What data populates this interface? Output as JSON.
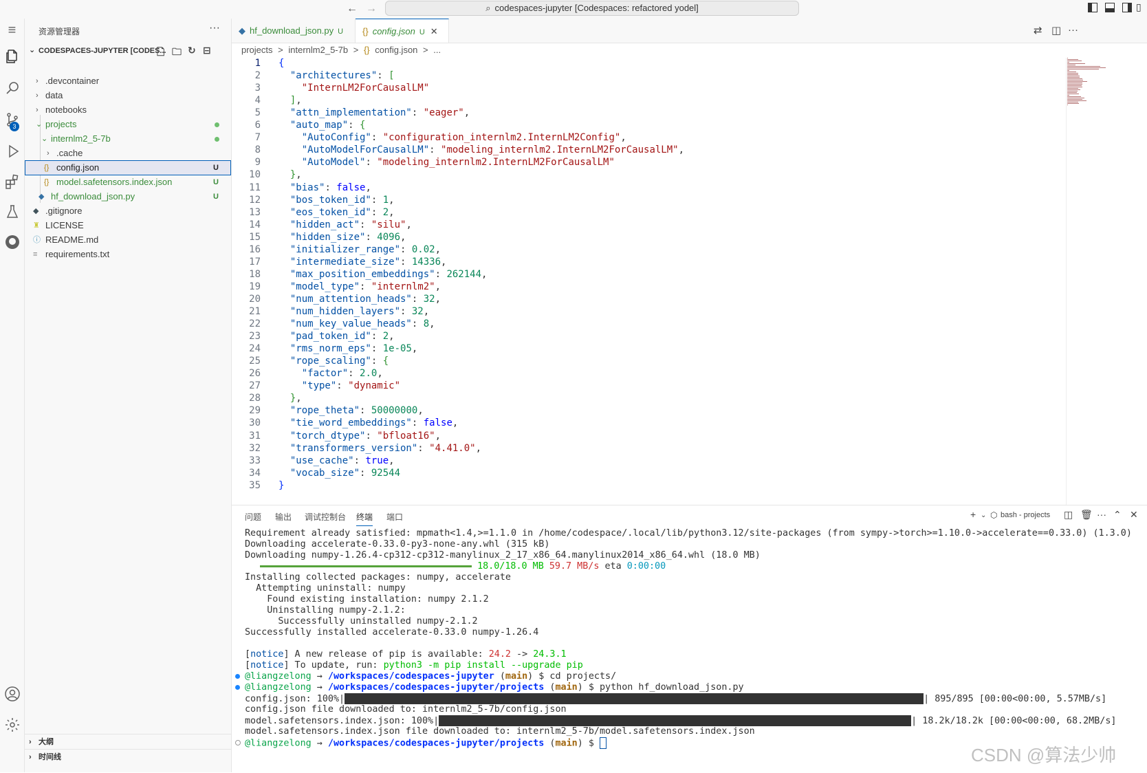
{
  "titlebar": {
    "command_center": "codespaces-jupyter [Codespaces: refactored yodel]",
    "back": "←",
    "forward": "→"
  },
  "activity": {
    "scm_badge": "3"
  },
  "sidebar": {
    "title": "资源管理器",
    "more": "···",
    "section": "CODESPACES-JUPYTER [CODES...",
    "tree": [
      {
        "label": ".devcontainer"
      },
      {
        "label": "data"
      },
      {
        "label": "notebooks"
      },
      {
        "label": "projects"
      },
      {
        "label": "internlm2_5-7b"
      },
      {
        "label": ".cache"
      },
      {
        "label": "config.json",
        "badge": "U",
        "icon": "{}"
      },
      {
        "label": "model.safetensors.index.json",
        "badge": "U",
        "icon": "{}"
      },
      {
        "label": "hf_download_json.py",
        "badge": "U"
      },
      {
        "label": ".gitignore"
      },
      {
        "label": "LICENSE"
      },
      {
        "label": "README.md"
      },
      {
        "label": "requirements.txt"
      }
    ],
    "outline": "大纲",
    "timeline": "时间线"
  },
  "tabs": [
    {
      "label": "hf_download_json.py",
      "mod": "U"
    },
    {
      "label": "config.json",
      "mod": "U",
      "icon": "{}",
      "close": "✕"
    }
  ],
  "breadcrumb": {
    "b1": "projects",
    "b2": "internlm2_5-7b",
    "icon": "{}",
    "b3": "config.json",
    "sep": ">",
    "b4": "..."
  },
  "editor": {
    "line_numbers": [
      "1",
      "2",
      "3",
      "4",
      "5",
      "6",
      "7",
      "8",
      "9",
      "10",
      "11",
      "12",
      "13",
      "14",
      "15",
      "16",
      "17",
      "18",
      "19",
      "20",
      "21",
      "22",
      "23",
      "24",
      "25",
      "26",
      "27",
      "28",
      "29",
      "30",
      "31",
      "32",
      "33",
      "34",
      "35"
    ],
    "lines": [
      [
        [
          "br1",
          "{"
        ]
      ],
      [
        [
          "p",
          "  "
        ],
        [
          "k",
          "\"architectures\""
        ],
        [
          "p",
          ": "
        ],
        [
          "br2",
          "["
        ]
      ],
      [
        [
          "p",
          "    "
        ],
        [
          "s",
          "\"InternLM2ForCausalLM\""
        ]
      ],
      [
        [
          "p",
          "  "
        ],
        [
          "br2",
          "]"
        ],
        [
          "p",
          ","
        ]
      ],
      [
        [
          "p",
          "  "
        ],
        [
          "k",
          "\"attn_implementation\""
        ],
        [
          "p",
          ": "
        ],
        [
          "s",
          "\"eager\""
        ],
        [
          "p",
          ","
        ]
      ],
      [
        [
          "p",
          "  "
        ],
        [
          "k",
          "\"auto_map\""
        ],
        [
          "p",
          ": "
        ],
        [
          "br2",
          "{"
        ]
      ],
      [
        [
          "p",
          "    "
        ],
        [
          "k",
          "\"AutoConfig\""
        ],
        [
          "p",
          ": "
        ],
        [
          "s",
          "\"configuration_internlm2.InternLM2Config\""
        ],
        [
          "p",
          ","
        ]
      ],
      [
        [
          "p",
          "    "
        ],
        [
          "k",
          "\"AutoModelForCausalLM\""
        ],
        [
          "p",
          ": "
        ],
        [
          "s",
          "\"modeling_internlm2.InternLM2ForCausalLM\""
        ],
        [
          "p",
          ","
        ]
      ],
      [
        [
          "p",
          "    "
        ],
        [
          "k",
          "\"AutoModel\""
        ],
        [
          "p",
          ": "
        ],
        [
          "s",
          "\"modeling_internlm2.InternLM2ForCausalLM\""
        ]
      ],
      [
        [
          "p",
          "  "
        ],
        [
          "br2",
          "}"
        ],
        [
          "p",
          ","
        ]
      ],
      [
        [
          "p",
          "  "
        ],
        [
          "k",
          "\"bias\""
        ],
        [
          "p",
          ": "
        ],
        [
          "b",
          "false"
        ],
        [
          "p",
          ","
        ]
      ],
      [
        [
          "p",
          "  "
        ],
        [
          "k",
          "\"bos_token_id\""
        ],
        [
          "p",
          ": "
        ],
        [
          "n",
          "1"
        ],
        [
          "p",
          ","
        ]
      ],
      [
        [
          "p",
          "  "
        ],
        [
          "k",
          "\"eos_token_id\""
        ],
        [
          "p",
          ": "
        ],
        [
          "n",
          "2"
        ],
        [
          "p",
          ","
        ]
      ],
      [
        [
          "p",
          "  "
        ],
        [
          "k",
          "\"hidden_act\""
        ],
        [
          "p",
          ": "
        ],
        [
          "s",
          "\"silu\""
        ],
        [
          "p",
          ","
        ]
      ],
      [
        [
          "p",
          "  "
        ],
        [
          "k",
          "\"hidden_size\""
        ],
        [
          "p",
          ": "
        ],
        [
          "n",
          "4096"
        ],
        [
          "p",
          ","
        ]
      ],
      [
        [
          "p",
          "  "
        ],
        [
          "k",
          "\"initializer_range\""
        ],
        [
          "p",
          ": "
        ],
        [
          "n",
          "0.02"
        ],
        [
          "p",
          ","
        ]
      ],
      [
        [
          "p",
          "  "
        ],
        [
          "k",
          "\"intermediate_size\""
        ],
        [
          "p",
          ": "
        ],
        [
          "n",
          "14336"
        ],
        [
          "p",
          ","
        ]
      ],
      [
        [
          "p",
          "  "
        ],
        [
          "k",
          "\"max_position_embeddings\""
        ],
        [
          "p",
          ": "
        ],
        [
          "n",
          "262144"
        ],
        [
          "p",
          ","
        ]
      ],
      [
        [
          "p",
          "  "
        ],
        [
          "k",
          "\"model_type\""
        ],
        [
          "p",
          ": "
        ],
        [
          "s",
          "\"internlm2\""
        ],
        [
          "p",
          ","
        ]
      ],
      [
        [
          "p",
          "  "
        ],
        [
          "k",
          "\"num_attention_heads\""
        ],
        [
          "p",
          ": "
        ],
        [
          "n",
          "32"
        ],
        [
          "p",
          ","
        ]
      ],
      [
        [
          "p",
          "  "
        ],
        [
          "k",
          "\"num_hidden_layers\""
        ],
        [
          "p",
          ": "
        ],
        [
          "n",
          "32"
        ],
        [
          "p",
          ","
        ]
      ],
      [
        [
          "p",
          "  "
        ],
        [
          "k",
          "\"num_key_value_heads\""
        ],
        [
          "p",
          ": "
        ],
        [
          "n",
          "8"
        ],
        [
          "p",
          ","
        ]
      ],
      [
        [
          "p",
          "  "
        ],
        [
          "k",
          "\"pad_token_id\""
        ],
        [
          "p",
          ": "
        ],
        [
          "n",
          "2"
        ],
        [
          "p",
          ","
        ]
      ],
      [
        [
          "p",
          "  "
        ],
        [
          "k",
          "\"rms_norm_eps\""
        ],
        [
          "p",
          ": "
        ],
        [
          "n",
          "1e-05"
        ],
        [
          "p",
          ","
        ]
      ],
      [
        [
          "p",
          "  "
        ],
        [
          "k",
          "\"rope_scaling\""
        ],
        [
          "p",
          ": "
        ],
        [
          "br2",
          "{"
        ]
      ],
      [
        [
          "p",
          "    "
        ],
        [
          "k",
          "\"factor\""
        ],
        [
          "p",
          ": "
        ],
        [
          "n",
          "2.0"
        ],
        [
          "p",
          ","
        ]
      ],
      [
        [
          "p",
          "    "
        ],
        [
          "k",
          "\"type\""
        ],
        [
          "p",
          ": "
        ],
        [
          "s",
          "\"dynamic\""
        ]
      ],
      [
        [
          "p",
          "  "
        ],
        [
          "br2",
          "}"
        ],
        [
          "p",
          ","
        ]
      ],
      [
        [
          "p",
          "  "
        ],
        [
          "k",
          "\"rope_theta\""
        ],
        [
          "p",
          ": "
        ],
        [
          "n",
          "50000000"
        ],
        [
          "p",
          ","
        ]
      ],
      [
        [
          "p",
          "  "
        ],
        [
          "k",
          "\"tie_word_embeddings\""
        ],
        [
          "p",
          ": "
        ],
        [
          "b",
          "false"
        ],
        [
          "p",
          ","
        ]
      ],
      [
        [
          "p",
          "  "
        ],
        [
          "k",
          "\"torch_dtype\""
        ],
        [
          "p",
          ": "
        ],
        [
          "s",
          "\"bfloat16\""
        ],
        [
          "p",
          ","
        ]
      ],
      [
        [
          "p",
          "  "
        ],
        [
          "k",
          "\"transformers_version\""
        ],
        [
          "p",
          ": "
        ],
        [
          "s",
          "\"4.41.0\""
        ],
        [
          "p",
          ","
        ]
      ],
      [
        [
          "p",
          "  "
        ],
        [
          "k",
          "\"use_cache\""
        ],
        [
          "p",
          ": "
        ],
        [
          "b",
          "true"
        ],
        [
          "p",
          ","
        ]
      ],
      [
        [
          "p",
          "  "
        ],
        [
          "k",
          "\"vocab_size\""
        ],
        [
          "p",
          ": "
        ],
        [
          "n",
          "92544"
        ]
      ],
      [
        [
          "br1",
          "}"
        ]
      ]
    ]
  },
  "panel": {
    "tabs": [
      "问题",
      "输出",
      "调试控制台",
      "终端",
      "端口"
    ],
    "terminal_label": "bash - projects",
    "term": {
      "l1": "Requirement already satisfied: mpmath<1.4,>=1.1.0 in /home/codespace/.local/lib/python3.12/site-packages (from sympy->torch>=1.10.0->accelerate==0.33.0) (1.3.0)",
      "l2": "Downloading accelerate-0.33.0-py3-none-any.whl (315 kB)",
      "l3": "Downloading numpy-1.26.4-cp312-cp312-manylinux_2_17_x86_64.manylinux2014_x86_64.whl (18.0 MB)",
      "l4_size": "18.0/18.0 MB",
      "l4_speed": "59.7 MB/s",
      "l4_eta_label": "eta",
      "l4_eta": "0:00:00",
      "l5": "Installing collected packages: numpy, accelerate",
      "l6": "  Attempting uninstall: numpy",
      "l7": "    Found existing installation: numpy 2.1.2",
      "l8": "    Uninstalling numpy-2.1.2:",
      "l9": "      Successfully uninstalled numpy-2.1.2",
      "l10": "Successfully installed accelerate-0.33.0 numpy-1.26.4",
      "notice": "notice",
      "n1_text": " A new release of pip is available: ",
      "n1_old": "24.2",
      "n1_arrow": " -> ",
      "n1_new": "24.3.1",
      "n2_text": " To update, run: ",
      "n2_cmd": "python3 -m pip install --upgrade pip",
      "user": "@liangzelong",
      "arrow": " → ",
      "path1": "/workspaces/codespaces-jupyter",
      "path2": "/workspaces/codespaces-jupyter/projects",
      "branch": "main",
      "cmd1": " $ cd projects/",
      "cmd2": " $ python hf_download_json.py",
      "dl1_prefix": "config.json: 100%|",
      "dl1_suffix": "| 895/895 [00:00<00:00, 5.57MB/s]",
      "dl1_done": "config.json file downloaded to: internlm2_5-7b/config.json",
      "dl2_prefix": "model.safetensors.index.json: 100%|",
      "dl2_suffix": "| 18.2k/18.2k [00:00<00:00, 68.2MB/s]",
      "dl2_done": "model.safetensors.index.json file downloaded to: internlm2_5-7b/model.safetensors.index.json",
      "prompt_end": " $ "
    }
  },
  "watermark": "CSDN @算法少帅",
  "colors": {
    "accent": "#005fb8",
    "git_untracked": "#3b8c3b"
  }
}
